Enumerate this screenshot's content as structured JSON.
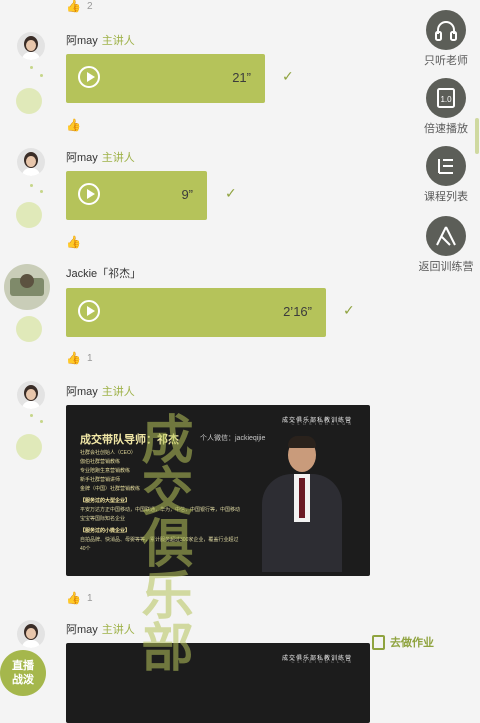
{
  "messages": [
    {
      "sender": "阿may",
      "role": "主讲人",
      "type": "voice",
      "duration": "21”"
    },
    {
      "sender": "阿may",
      "role": "主讲人",
      "type": "voice",
      "duration": "9”"
    },
    {
      "sender": "Jackie「祁杰」",
      "role": "",
      "type": "voice",
      "duration": "2’16”"
    },
    {
      "sender": "阿may",
      "role": "主讲人",
      "type": "image"
    },
    {
      "sender": "阿may",
      "role": "主讲人",
      "type": "image"
    }
  ],
  "likes": [
    {
      "icon": "thumbs-up-icon",
      "count": "2"
    },
    {
      "icon": "thumbs-up-icon",
      "count": ""
    },
    {
      "icon": "thumbs-up-icon",
      "count": ""
    },
    {
      "icon": "thumbs-up-icon",
      "count": "1"
    },
    {
      "icon": "thumbs-up-icon",
      "count": "1"
    }
  ],
  "slide1": {
    "brand": "成交俱乐部私教训练营",
    "brand_sub": "C L O S I N G   C L U B",
    "title": "成交带队导师：祁杰",
    "wechat": "个人微信：jackieqijie",
    "bullets": [
      "社群会社创始人（CEO）",
      "伽伯社群营销教练",
      "专业陪跑生意营销教练",
      "新手社群营销讲师",
      "金牌（中国）社群营销教练"
    ],
    "h1": "【服务过的大型企业】",
    "p1": "平安万达方正中国移动，中国联通，华为，中信，中国银行等，中国移动宝宝等国际知名企业",
    "h2": "【服务过的小微企业】",
    "p2": "自拍品牌、快消品、母婴等等，累计服务超过300家企业，覆盖行业超过40个"
  },
  "slide2": {
    "brand": "成交俱乐部私教训练营",
    "brand_sub": "C L O S I N G   C L U B"
  },
  "watermark": "成交俱乐部",
  "side_buttons": [
    {
      "label": "只听老师",
      "icon": "headphones-icon"
    },
    {
      "label": "倍速播放",
      "icon": "speed-play-icon"
    },
    {
      "label": "课程列表",
      "icon": "course-list-icon"
    },
    {
      "label": "返回训练营",
      "icon": "return-camp-icon"
    }
  ],
  "homework": "去做作业",
  "live_badge": "直播\n战泼",
  "colors": {
    "accent": "#b5c35a",
    "accent_dark": "#8fa33f",
    "side_button": "#5c5e58",
    "background": "#f4f4f4"
  }
}
